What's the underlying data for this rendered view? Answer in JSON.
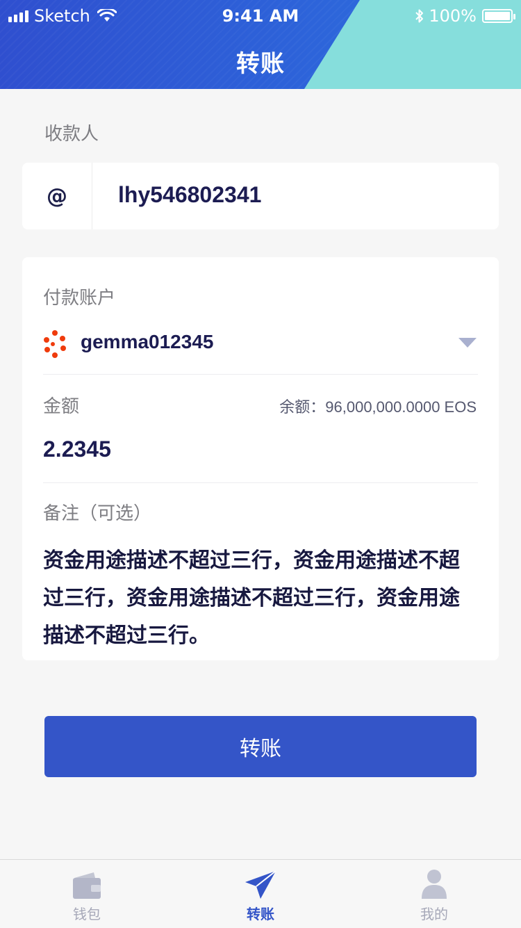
{
  "status_bar": {
    "carrier": "Sketch",
    "time": "9:41 AM",
    "battery": "100%"
  },
  "nav": {
    "title": "转账"
  },
  "recipient": {
    "label": "收款人",
    "prefix": "@",
    "value": "lhy546802341"
  },
  "payment": {
    "account_label": "付款账户",
    "account_name": "gemma012345",
    "amount_label": "金额",
    "balance_text": "余额：96,000,000.0000 EOS",
    "amount_value": "2.2345",
    "memo_label": "备注（可选）",
    "memo_text": "资金用途描述不超过三行，资金用途描述不超过三行，资金用途描述不超过三行，资金用途描述不超过三行。"
  },
  "primary_button": {
    "label": "转账"
  },
  "tabbar": {
    "items": [
      {
        "label": "钱包",
        "icon": "wallet-icon",
        "active": false
      },
      {
        "label": "转账",
        "icon": "paper-plane-icon",
        "active": true
      },
      {
        "label": "我的",
        "icon": "user-icon",
        "active": false
      }
    ]
  },
  "colors": {
    "primary": "#3455c8",
    "header_blue": "#2f4fcf",
    "header_teal": "#86dedc",
    "account_logo": "#ef3b0c",
    "inactive_tab": "#a6a8b8"
  }
}
